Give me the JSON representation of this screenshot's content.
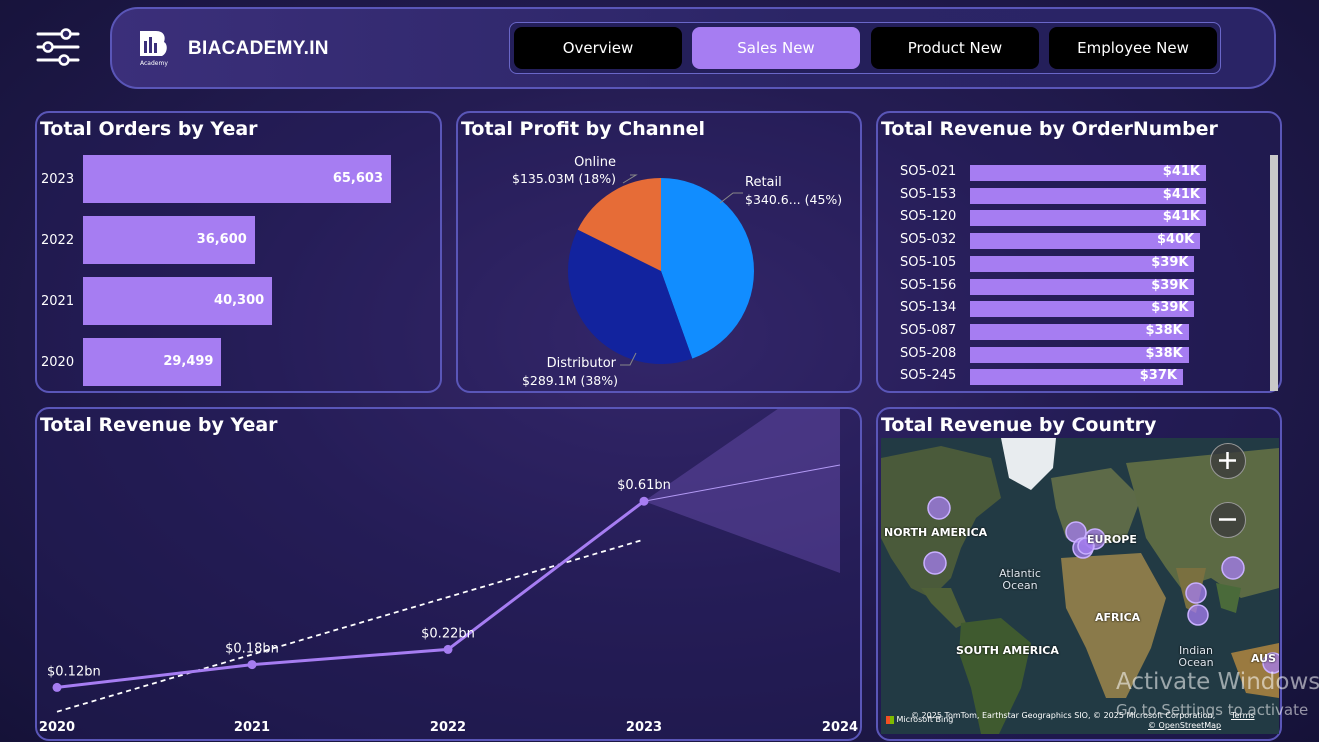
{
  "header": {
    "brand": "BIACADEMY.IN",
    "logo_sub": "Academy",
    "tabs": [
      {
        "label": "Overview",
        "active": false
      },
      {
        "label": "Sales New",
        "active": true
      },
      {
        "label": "Product New",
        "active": false
      },
      {
        "label": "Employee New",
        "active": false
      }
    ]
  },
  "orders_by_year": {
    "title": "Total Orders by Year",
    "chart_data": {
      "type": "bar",
      "categories": [
        "2023",
        "2022",
        "2021",
        "2020"
      ],
      "values": [
        65603,
        36600,
        40300,
        29499
      ],
      "labels": [
        "65,603",
        "36,600",
        "40,300",
        "29,499"
      ],
      "xlim": [
        0,
        70000
      ]
    }
  },
  "profit_by_channel": {
    "title": "Total Profit by Channel",
    "chart_data": {
      "type": "pie",
      "categories": [
        "Retail",
        "Distributor",
        "Online"
      ],
      "values": [
        340.6,
        289.1,
        135.03
      ],
      "shares": [
        45,
        38,
        18
      ],
      "labels": [
        {
          "name": "Retail",
          "value": "$340.6... (45%)"
        },
        {
          "name": "Distributor",
          "value": "$289.1M (38%)"
        },
        {
          "name": "Online",
          "value": "$135.03M (18%)"
        }
      ],
      "colors": [
        "#118dff",
        "#12239e",
        "#e66c37"
      ]
    }
  },
  "revenue_by_order": {
    "title": "Total Revenue by OrderNumber",
    "chart_data": {
      "type": "bar",
      "categories": [
        "SO5-021",
        "SO5-153",
        "SO5-120",
        "SO5-032",
        "SO5-105",
        "SO5-156",
        "SO5-134",
        "SO5-087",
        "SO5-208",
        "SO5-245"
      ],
      "values": [
        41,
        41,
        41,
        40,
        39,
        39,
        39,
        38,
        38,
        37
      ],
      "labels": [
        "$41K",
        "$41K",
        "$41K",
        "$40K",
        "$39K",
        "$39K",
        "$39K",
        "$38K",
        "$38K",
        "$37K"
      ],
      "unit": "K"
    }
  },
  "revenue_by_year": {
    "title": "Total Revenue by Year",
    "chart_data": {
      "type": "line",
      "x": [
        "2020",
        "2021",
        "2022",
        "2023",
        "2024"
      ],
      "values": [
        0.12,
        0.18,
        0.22,
        0.61
      ],
      "labels": [
        "$0.12bn",
        "$0.18bn",
        "$0.22bn",
        "$0.61bn"
      ],
      "unit": "bn",
      "trendline": true,
      "forecast": {
        "x": "2024",
        "value": 0.7,
        "lower": 0.5,
        "upper": 0.9
      }
    }
  },
  "revenue_by_country": {
    "title": "Total Revenue by Country",
    "map_labels": {
      "north_america": "NORTH AMERICA",
      "europe": "EUROPE",
      "africa": "AFRICA",
      "south_america": "SOUTH AMERICA",
      "atlantic": "Atlantic Ocean",
      "indian": "Indian Ocean",
      "australia": "AUS"
    },
    "attribution": "© 2025 TomTom, Earthstar Geographics SIO, © 2025 Microsoft Corporation,",
    "terms": "Terms",
    "osm": "© OpenStreetMap",
    "bing": "Microsoft Bing"
  },
  "watermark": {
    "line1": "Activate Windows",
    "line2": "Go to Settings to activate"
  },
  "colors": {
    "accent": "#a67df2",
    "panel_border": "#5a56b8",
    "pie_retail": "#118dff",
    "pie_distributor": "#12239e",
    "pie_online": "#e66c37"
  }
}
